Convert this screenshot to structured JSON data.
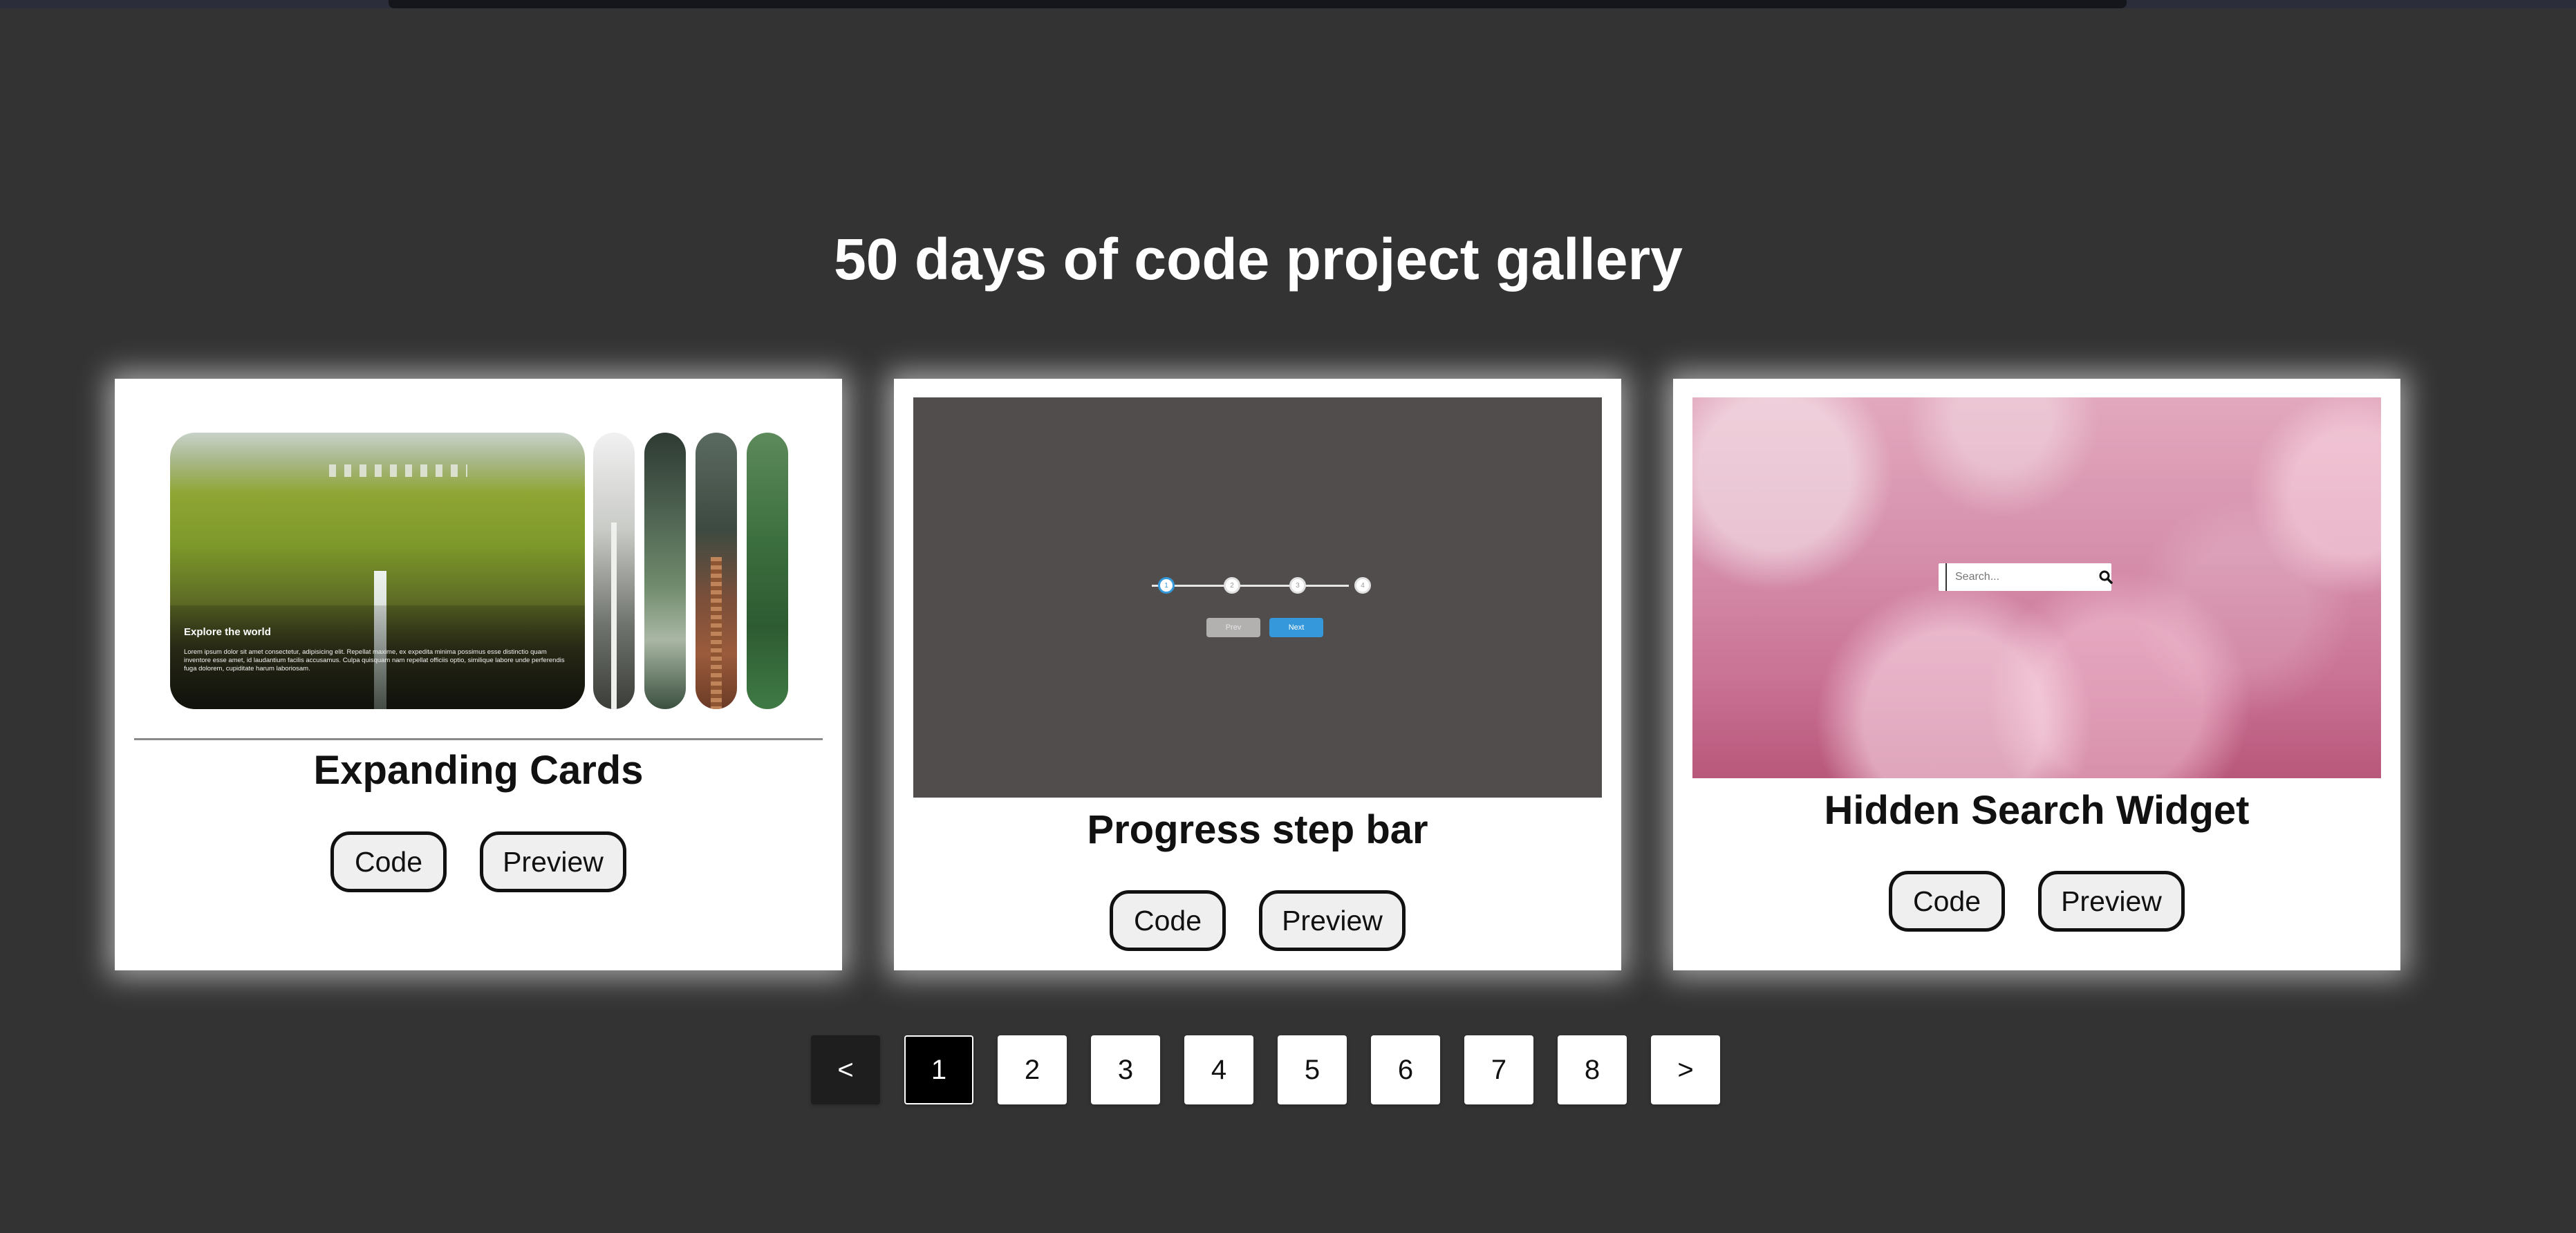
{
  "page": {
    "title": "50 days of code project gallery"
  },
  "cards": [
    {
      "name": "Expanding Cards",
      "code_label": "Code",
      "preview_label": "Preview",
      "thumbnail": {
        "panel_title": "Explore the world",
        "panel_text": "Lorem ipsum dolor sit amet consectetur, adipisicing elit. Repellat maxime, ex expedita minima possimus esse distinctio quam inventore esse amet, id laudantium facilis accusamus. Culpa quisquam nam repellat officiis optio, similique labore unde perferendis fuga dolorem, cupiditate harum laboriosam."
      }
    },
    {
      "name": "Progress step bar",
      "code_label": "Code",
      "preview_label": "Preview",
      "thumbnail": {
        "steps": [
          "1",
          "2",
          "3",
          "4"
        ],
        "active_step": 1,
        "prev_label": "Prev",
        "next_label": "Next"
      }
    },
    {
      "name": "Hidden Search Widget",
      "code_label": "Code",
      "preview_label": "Preview",
      "thumbnail": {
        "search_placeholder": "Search..."
      }
    }
  ],
  "pagination": {
    "prev_label": "<",
    "next_label": ">",
    "pages": [
      "1",
      "2",
      "3",
      "4",
      "5",
      "6",
      "7",
      "8"
    ],
    "current_page": 1
  },
  "colors": {
    "background": "#333333",
    "card": "#ffffff",
    "accent_blue": "#3498db",
    "current_page": "#000000"
  }
}
